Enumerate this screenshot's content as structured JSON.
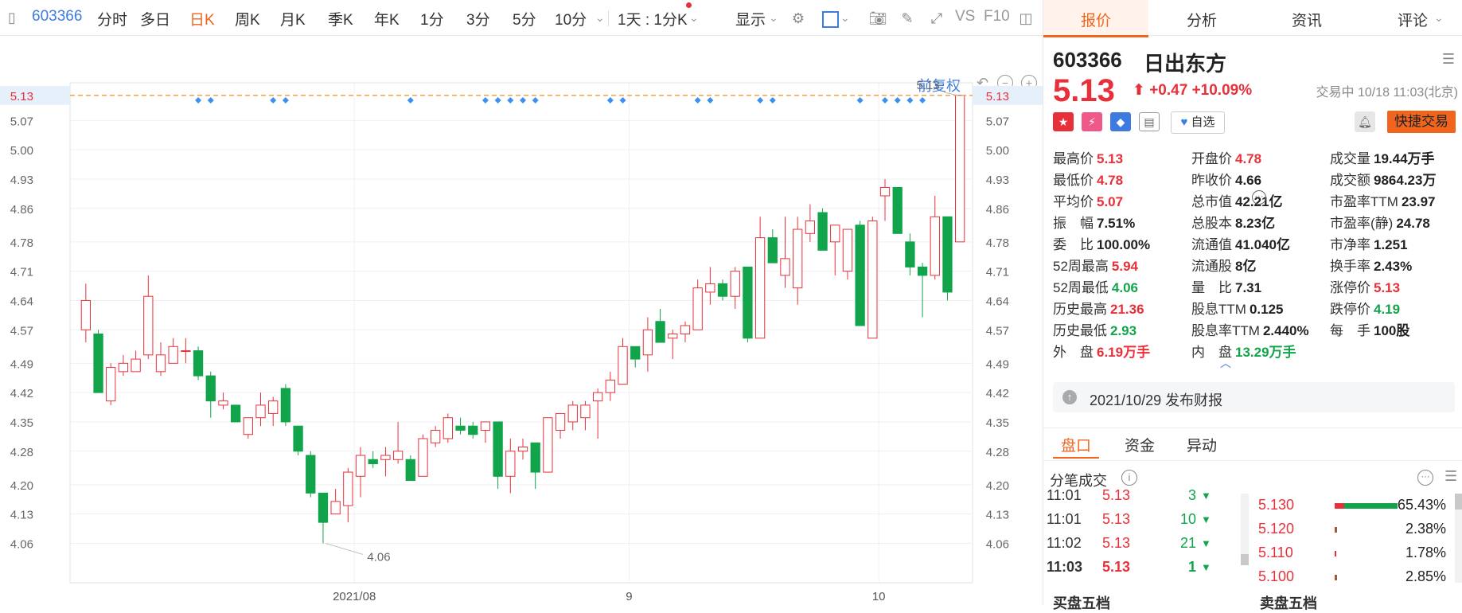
{
  "toolbar": {
    "code": "603366",
    "items": [
      "分时",
      "多日",
      "日K",
      "周K",
      "月K",
      "季K",
      "年K",
      "1分",
      "3分",
      "5分",
      "10分"
    ],
    "active_index": 2,
    "period_select": "1天 : 1分K",
    "display_label": "显示",
    "vs_label": "VS",
    "f10_label": "F10"
  },
  "chart": {
    "fq_label": "前复权",
    "price_tag": "5.13",
    "high_annotation": "5.13",
    "low_annotation": "4.06",
    "accent_up": "#e8303a",
    "accent_down": "#11a44a",
    "dash_color": "#f5a04a"
  },
  "chart_data": {
    "type": "candlestick",
    "ylim": [
      4.0,
      5.16
    ],
    "y_ticks": [
      "5.13",
      "5.07",
      "5.00",
      "4.93",
      "4.86",
      "4.78",
      "4.71",
      "4.64",
      "4.57",
      "4.49",
      "4.42",
      "4.35",
      "4.28",
      "4.20",
      "4.13",
      "4.06"
    ],
    "x_ticks": [
      "2021/08",
      "9",
      "10"
    ],
    "x_tick_index": [
      22,
      44,
      64
    ],
    "marker_indices": [
      9,
      10,
      15,
      16,
      26,
      32,
      33,
      34,
      35,
      36,
      42,
      43,
      49,
      50,
      54,
      55,
      62,
      64,
      65,
      66,
      67
    ],
    "candles": [
      {
        "o": 4.57,
        "c": 4.64,
        "h": 4.68,
        "l": 4.54
      },
      {
        "o": 4.56,
        "c": 4.42,
        "h": 4.57,
        "l": 4.42
      },
      {
        "o": 4.4,
        "c": 4.48,
        "h": 4.49,
        "l": 4.39
      },
      {
        "o": 4.47,
        "c": 4.49,
        "h": 4.51,
        "l": 4.46
      },
      {
        "o": 4.47,
        "c": 4.5,
        "h": 4.52,
        "l": 4.47
      },
      {
        "o": 4.51,
        "c": 4.65,
        "h": 4.7,
        "l": 4.5
      },
      {
        "o": 4.47,
        "c": 4.51,
        "h": 4.54,
        "l": 4.46
      },
      {
        "o": 4.49,
        "c": 4.53,
        "h": 4.55,
        "l": 4.49
      },
      {
        "o": 4.52,
        "c": 4.52,
        "h": 4.55,
        "l": 4.49
      },
      {
        "o": 4.52,
        "c": 4.46,
        "h": 4.53,
        "l": 4.45
      },
      {
        "o": 4.46,
        "c": 4.4,
        "h": 4.47,
        "l": 4.36
      },
      {
        "o": 4.39,
        "c": 4.4,
        "h": 4.42,
        "l": 4.38
      },
      {
        "o": 4.39,
        "c": 4.35,
        "h": 4.39,
        "l": 4.35
      },
      {
        "o": 4.32,
        "c": 4.36,
        "h": 4.36,
        "l": 4.31
      },
      {
        "o": 4.36,
        "c": 4.39,
        "h": 4.42,
        "l": 4.34
      },
      {
        "o": 4.37,
        "c": 4.4,
        "h": 4.41,
        "l": 4.34
      },
      {
        "o": 4.43,
        "c": 4.35,
        "h": 4.44,
        "l": 4.34
      },
      {
        "o": 4.34,
        "c": 4.28,
        "h": 4.34,
        "l": 4.27
      },
      {
        "o": 4.27,
        "c": 4.18,
        "h": 4.28,
        "l": 4.17
      },
      {
        "o": 4.18,
        "c": 4.11,
        "h": 4.18,
        "l": 4.06
      },
      {
        "o": 4.13,
        "c": 4.16,
        "h": 4.19,
        "l": 4.13
      },
      {
        "o": 4.15,
        "c": 4.23,
        "h": 4.24,
        "l": 4.11
      },
      {
        "o": 4.22,
        "c": 4.27,
        "h": 4.29,
        "l": 4.17
      },
      {
        "o": 4.26,
        "c": 4.25,
        "h": 4.28,
        "l": 4.24
      },
      {
        "o": 4.26,
        "c": 4.27,
        "h": 4.29,
        "l": 4.22
      },
      {
        "o": 4.26,
        "c": 4.28,
        "h": 4.35,
        "l": 4.25
      },
      {
        "o": 4.26,
        "c": 4.21,
        "h": 4.27,
        "l": 4.21
      },
      {
        "o": 4.22,
        "c": 4.31,
        "h": 4.32,
        "l": 4.22
      },
      {
        "o": 4.3,
        "c": 4.33,
        "h": 4.34,
        "l": 4.29
      },
      {
        "o": 4.31,
        "c": 4.36,
        "h": 4.37,
        "l": 4.3
      },
      {
        "o": 4.34,
        "c": 4.33,
        "h": 4.36,
        "l": 4.32
      },
      {
        "o": 4.34,
        "c": 4.32,
        "h": 4.35,
        "l": 4.31
      },
      {
        "o": 4.33,
        "c": 4.35,
        "h": 4.35,
        "l": 4.3
      },
      {
        "o": 4.35,
        "c": 4.22,
        "h": 4.35,
        "l": 4.19
      },
      {
        "o": 4.22,
        "c": 4.28,
        "h": 4.31,
        "l": 4.18
      },
      {
        "o": 4.28,
        "c": 4.29,
        "h": 4.31,
        "l": 4.26
      },
      {
        "o": 4.3,
        "c": 4.23,
        "h": 4.3,
        "l": 4.19
      },
      {
        "o": 4.23,
        "c": 4.36,
        "h": 4.36,
        "l": 4.23
      },
      {
        "o": 4.33,
        "c": 4.37,
        "h": 4.37,
        "l": 4.31
      },
      {
        "o": 4.35,
        "c": 4.39,
        "h": 4.4,
        "l": 4.33
      },
      {
        "o": 4.36,
        "c": 4.39,
        "h": 4.4,
        "l": 4.33
      },
      {
        "o": 4.4,
        "c": 4.42,
        "h": 4.43,
        "l": 4.31
      },
      {
        "o": 4.42,
        "c": 4.45,
        "h": 4.47,
        "l": 4.4
      },
      {
        "o": 4.44,
        "c": 4.53,
        "h": 4.55,
        "l": 4.44
      },
      {
        "o": 4.53,
        "c": 4.5,
        "h": 4.53,
        "l": 4.48
      },
      {
        "o": 4.51,
        "c": 4.57,
        "h": 4.6,
        "l": 4.47
      },
      {
        "o": 4.59,
        "c": 4.54,
        "h": 4.62,
        "l": 4.54
      },
      {
        "o": 4.55,
        "c": 4.56,
        "h": 4.57,
        "l": 4.5
      },
      {
        "o": 4.56,
        "c": 4.58,
        "h": 4.59,
        "l": 4.54
      },
      {
        "o": 4.57,
        "c": 4.67,
        "h": 4.69,
        "l": 4.57
      },
      {
        "o": 4.66,
        "c": 4.68,
        "h": 4.72,
        "l": 4.63
      },
      {
        "o": 4.68,
        "c": 4.65,
        "h": 4.69,
        "l": 4.64
      },
      {
        "o": 4.65,
        "c": 4.71,
        "h": 4.72,
        "l": 4.62
      },
      {
        "o": 4.72,
        "c": 4.55,
        "h": 4.72,
        "l": 4.54
      },
      {
        "o": 4.55,
        "c": 4.79,
        "h": 4.84,
        "l": 4.55
      },
      {
        "o": 4.79,
        "c": 4.73,
        "h": 4.81,
        "l": 4.73
      },
      {
        "o": 4.7,
        "c": 4.74,
        "h": 4.84,
        "l": 4.67
      },
      {
        "o": 4.67,
        "c": 4.81,
        "h": 4.84,
        "l": 4.63
      },
      {
        "o": 4.8,
        "c": 4.83,
        "h": 4.87,
        "l": 4.78
      },
      {
        "o": 4.85,
        "c": 4.76,
        "h": 4.86,
        "l": 4.76
      },
      {
        "o": 4.78,
        "c": 4.82,
        "h": 4.82,
        "l": 4.7
      },
      {
        "o": 4.71,
        "c": 4.81,
        "h": 4.81,
        "l": 4.69
      },
      {
        "o": 4.82,
        "c": 4.58,
        "h": 4.83,
        "l": 4.58
      },
      {
        "o": 4.55,
        "c": 4.83,
        "h": 4.84,
        "l": 4.55
      },
      {
        "o": 4.89,
        "c": 4.91,
        "h": 4.93,
        "l": 4.83
      },
      {
        "o": 4.91,
        "c": 4.8,
        "h": 4.91,
        "l": 4.8
      },
      {
        "o": 4.78,
        "c": 4.72,
        "h": 4.8,
        "l": 4.7
      },
      {
        "o": 4.72,
        "c": 4.7,
        "h": 4.73,
        "l": 4.6
      },
      {
        "o": 4.7,
        "c": 4.84,
        "h": 4.89,
        "l": 4.69
      },
      {
        "o": 4.84,
        "c": 4.66,
        "h": 4.84,
        "l": 4.64
      },
      {
        "o": 4.78,
        "c": 5.13,
        "h": 5.13,
        "l": 4.78
      }
    ]
  },
  "panel": {
    "tabs": [
      "报价",
      "分析",
      "资讯",
      "评论"
    ],
    "code": "603366",
    "name": "日出东方",
    "price": "5.13",
    "arrow": "⬆",
    "change": "+0.47",
    "change_pct": "+10.09%",
    "status": "交易中 10/18 11:03(北京)",
    "zixuan_label": "自选",
    "fast_trade_label": "快捷交易",
    "quote": [
      [
        [
          "最高价",
          "5.13",
          "red"
        ],
        [
          "开盘价",
          "4.78",
          "red"
        ],
        [
          "成交量",
          "19.44万手",
          ""
        ]
      ],
      [
        [
          "最低价",
          "4.78",
          "red"
        ],
        [
          "昨收价",
          "4.66",
          ""
        ],
        [
          "成交额",
          "9864.23万",
          ""
        ]
      ],
      [
        [
          "平均价",
          "5.07",
          "red"
        ],
        [
          "总市值",
          "42.21亿",
          ""
        ],
        [
          "市盈率TTM",
          "23.97",
          ""
        ]
      ],
      [
        [
          "振　幅",
          "7.51%",
          ""
        ],
        [
          "总股本",
          "8.23亿",
          ""
        ],
        [
          "市盈率(静)",
          "24.78",
          ""
        ]
      ],
      [
        [
          "委　比",
          "100.00%",
          ""
        ],
        [
          "流通值",
          "41.040亿",
          ""
        ],
        [
          "市净率",
          "1.251",
          ""
        ]
      ],
      [
        [
          "52周最高",
          "5.94",
          "red"
        ],
        [
          "流通股",
          "8亿",
          ""
        ],
        [
          "换手率",
          "2.43%",
          ""
        ]
      ],
      [
        [
          "52周最低",
          "4.06",
          "green"
        ],
        [
          "量　比",
          "7.31",
          ""
        ],
        [
          "涨停价",
          "5.13",
          "red"
        ]
      ],
      [
        [
          "历史最高",
          "21.36",
          "red"
        ],
        [
          "股息TTM",
          "0.125",
          ""
        ],
        [
          "跌停价",
          "4.19",
          "green"
        ]
      ],
      [
        [
          "历史最低",
          "2.93",
          "green"
        ],
        [
          "股息率TTM",
          "2.440%",
          ""
        ],
        [
          "每　手",
          "100股",
          ""
        ]
      ],
      [
        [
          "外　盘",
          "6.19万手",
          "red"
        ],
        [
          "内　盘",
          "13.29万手",
          "green"
        ]
      ]
    ],
    "notice": "2021/10/29  发布财报",
    "subtabs": [
      "盘口",
      "资金",
      "异动"
    ],
    "ticks_title": "分笔成交",
    "ticks": [
      {
        "time": "11:01",
        "price": "5.13",
        "vol": "3"
      },
      {
        "time": "11:01",
        "price": "5.13",
        "vol": "10"
      },
      {
        "time": "11:02",
        "price": "5.13",
        "vol": "21"
      },
      {
        "time": "11:03",
        "price": "5.13",
        "vol": "1"
      }
    ],
    "orderbook": [
      {
        "price": "5.130",
        "pct": "65.43%",
        "fill": 0.6543
      },
      {
        "price": "5.120",
        "pct": "2.38%",
        "fill": 0.0238
      },
      {
        "price": "5.110",
        "pct": "1.78%",
        "fill": 0.0178
      },
      {
        "price": "5.100",
        "pct": "2.85%",
        "fill": 0.0285
      }
    ],
    "buy5": "买盘五档",
    "sell5": "卖盘五档"
  }
}
